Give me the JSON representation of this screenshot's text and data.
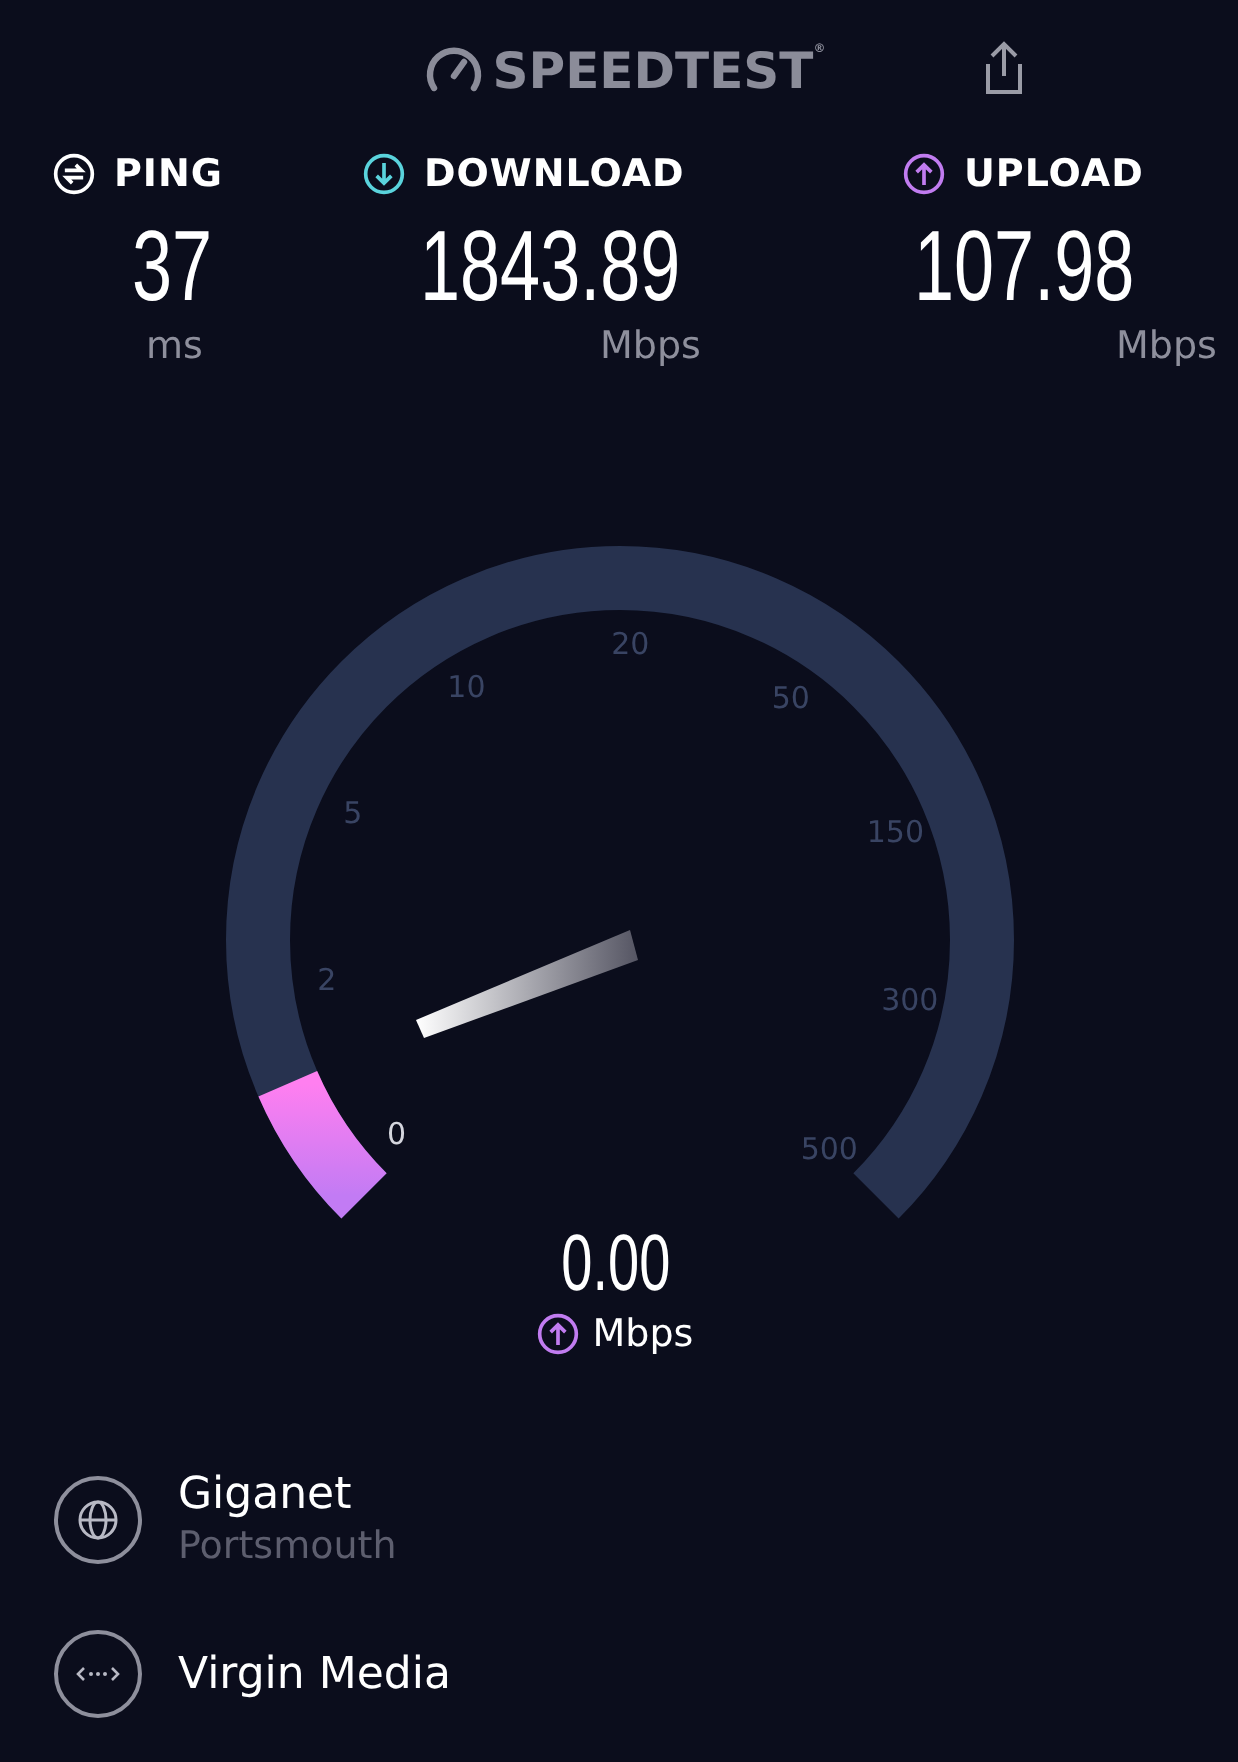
{
  "header": {
    "logo": "SPEEDTEST",
    "logo_mark": "®"
  },
  "stats": [
    {
      "kind": "ping",
      "label": "PING",
      "value": "37",
      "unit": "ms"
    },
    {
      "kind": "download",
      "label": "DOWNLOAD",
      "value": "1843.89",
      "unit": "Mbps"
    },
    {
      "kind": "upload",
      "label": "UPLOAD",
      "value": "107.98",
      "unit": "Mbps"
    }
  ],
  "gauge": {
    "ticks": [
      "0",
      "2",
      "5",
      "10",
      "20",
      "50",
      "150",
      "300",
      "500"
    ],
    "reading": "0.00",
    "unit": "Mbps"
  },
  "servers": [
    {
      "kind": "host",
      "name": "Giganet",
      "location": "Portsmouth"
    },
    {
      "kind": "provider",
      "name": "Virgin Media"
    }
  ]
}
